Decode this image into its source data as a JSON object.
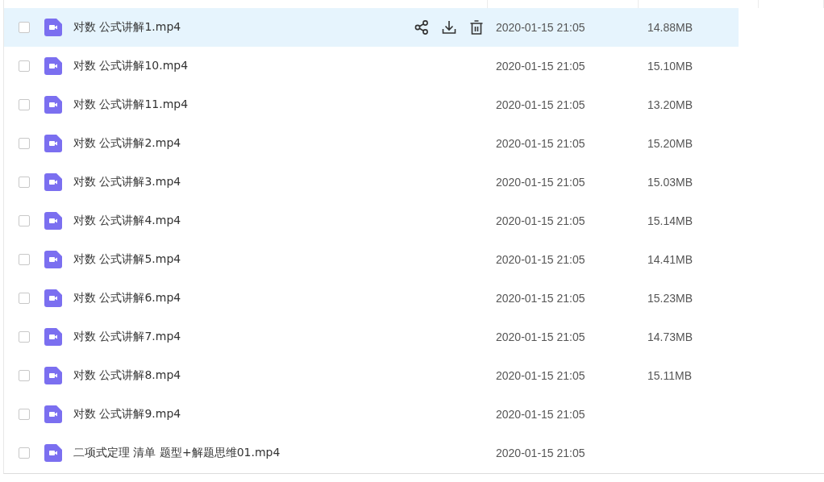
{
  "files": [
    {
      "name": "对数 公式讲解1.mp4",
      "date": "2020-01-15 21:05",
      "size": "14.88MB",
      "checked": false,
      "highlighted": true
    },
    {
      "name": "对数 公式讲解10.mp4",
      "date": "2020-01-15 21:05",
      "size": "15.10MB",
      "checked": false,
      "highlighted": false
    },
    {
      "name": "对数 公式讲解11.mp4",
      "date": "2020-01-15 21:05",
      "size": "13.20MB",
      "checked": false,
      "highlighted": false
    },
    {
      "name": "对数 公式讲解2.mp4",
      "date": "2020-01-15 21:05",
      "size": "15.20MB",
      "checked": false,
      "highlighted": false
    },
    {
      "name": "对数 公式讲解3.mp4",
      "date": "2020-01-15 21:05",
      "size": "15.03MB",
      "checked": false,
      "highlighted": false
    },
    {
      "name": "对数 公式讲解4.mp4",
      "date": "2020-01-15 21:05",
      "size": "15.14MB",
      "checked": false,
      "highlighted": false
    },
    {
      "name": "对数 公式讲解5.mp4",
      "date": "2020-01-15 21:05",
      "size": "14.41MB",
      "checked": false,
      "highlighted": false
    },
    {
      "name": "对数 公式讲解6.mp4",
      "date": "2020-01-15 21:05",
      "size": "15.23MB",
      "checked": false,
      "highlighted": false
    },
    {
      "name": "对数 公式讲解7.mp4",
      "date": "2020-01-15 21:05",
      "size": "14.73MB",
      "checked": false,
      "highlighted": false
    },
    {
      "name": "对数 公式讲解8.mp4",
      "date": "2020-01-15 21:05",
      "size": "15.11MB",
      "checked": false,
      "highlighted": false
    },
    {
      "name": "对数 公式讲解9.mp4",
      "date": "2020-01-15 21:05",
      "checked": false,
      "highlighted": false
    },
    {
      "name": "二项式定理 清单 题型+解题思维01.mp4",
      "date": "2020-01-15 21:05",
      "checked": false,
      "highlighted": false
    }
  ]
}
